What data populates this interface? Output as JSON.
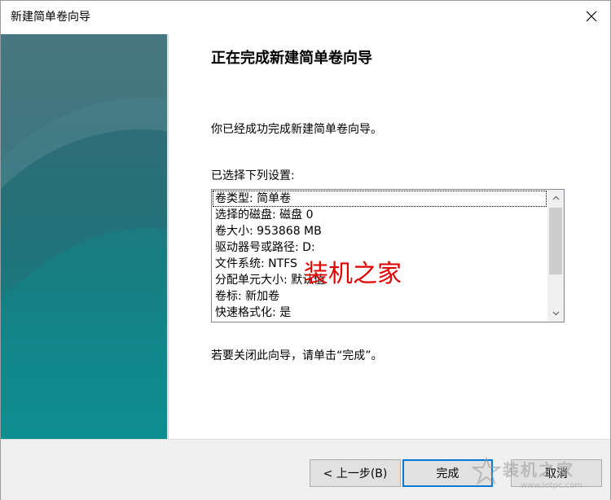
{
  "window": {
    "title": "新建简单卷向导",
    "close_icon": "close-icon"
  },
  "content": {
    "heading": "正在完成新建简单卷向导",
    "intro": "你已经成功完成新建简单卷向导。",
    "settings_label": "已选择下列设置:",
    "settings": [
      "卷类型: 简单卷",
      "选择的磁盘: 磁盘 0",
      "卷大小: 953868 MB",
      "驱动器号或路径: D:",
      "文件系统: NTFS",
      "分配单元大小: 默认值",
      "卷标: 新加卷",
      "快速格式化: 是"
    ],
    "close_hint": "若要关闭此向导，请单击“完成”。"
  },
  "watermark": {
    "text": "装机之家",
    "logo_text": "装机之家",
    "logo_url": "www.lotpc.com"
  },
  "buttons": {
    "back": "< 上一步(B)",
    "finish": "完成",
    "cancel": "取消"
  },
  "colors": {
    "accent": "#0078d7",
    "banner_top": "#3f707a",
    "banner_bottom": "#0e8f91",
    "watermark": "#e10000"
  }
}
